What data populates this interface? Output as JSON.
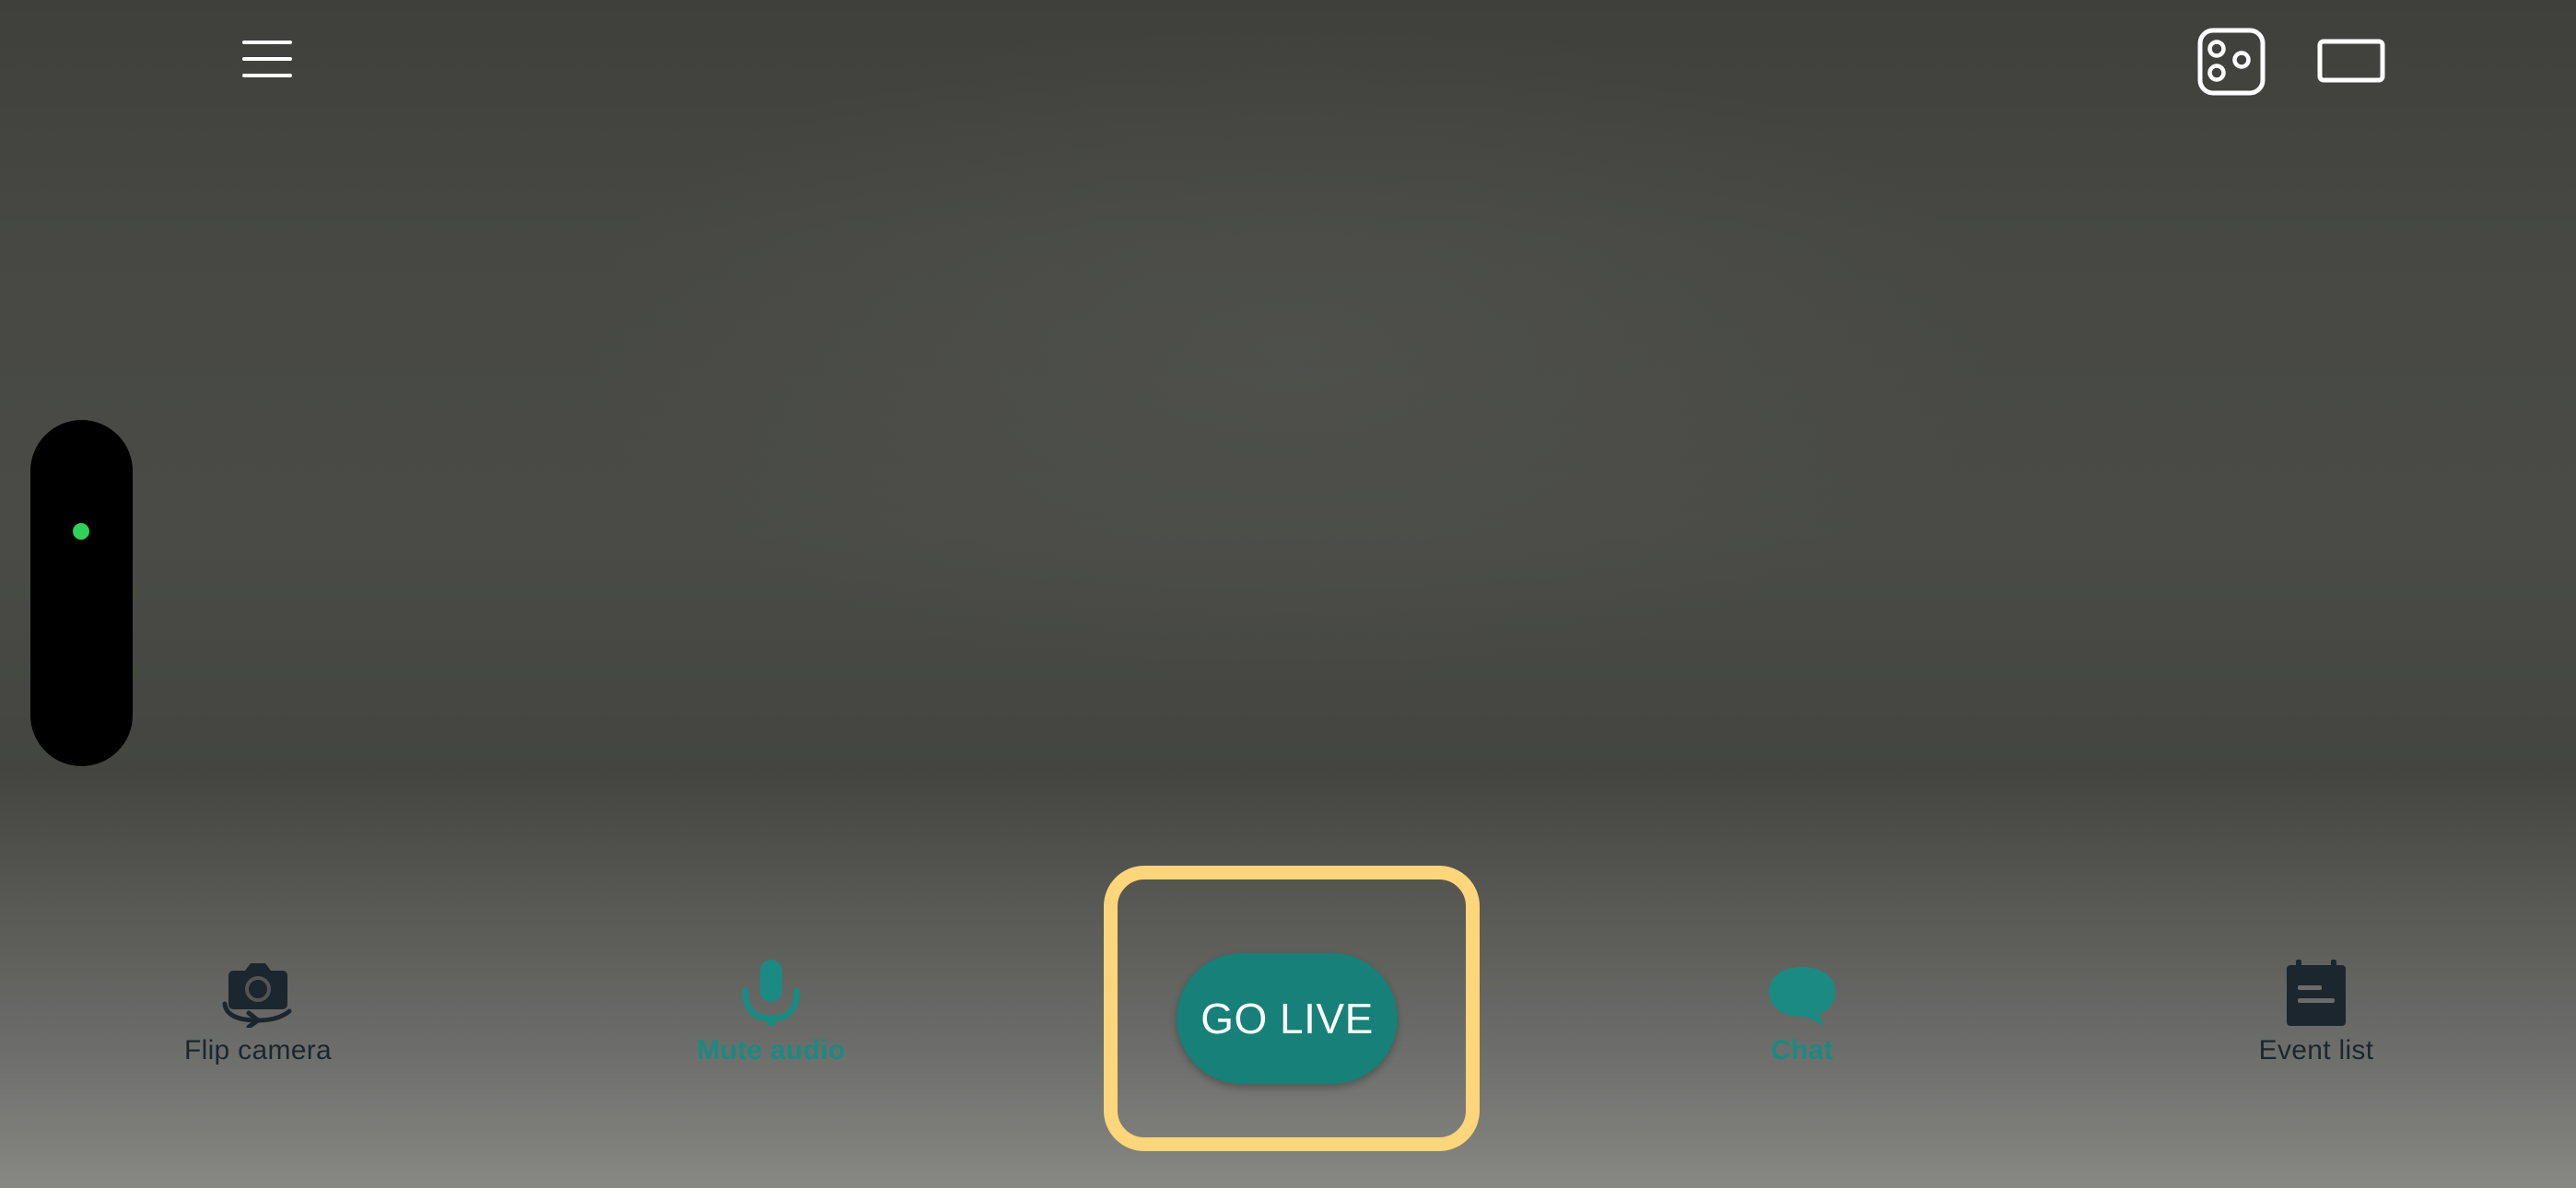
{
  "app": {
    "accent_color": "#178078",
    "highlight_color": "#fdd57a",
    "status_color": "#2fd158"
  },
  "top_bar": {
    "menu_icon": "hamburger-menu-icon",
    "layout_icon": "camera-layout-icon",
    "aspect_icon": "aspect-ratio-icon"
  },
  "side_panel": {
    "status": "live-indicator-dot"
  },
  "controls": {
    "flip_camera": {
      "label": "Flip camera",
      "icon": "flip-camera-icon"
    },
    "mute_audio": {
      "label": "Mute audio",
      "icon": "microphone-icon"
    },
    "go_live": {
      "label": "GO LIVE"
    },
    "chat": {
      "label": "Chat",
      "icon": "chat-bubble-icon"
    },
    "event_list": {
      "label": "Event list",
      "icon": "event-list-icon"
    }
  }
}
